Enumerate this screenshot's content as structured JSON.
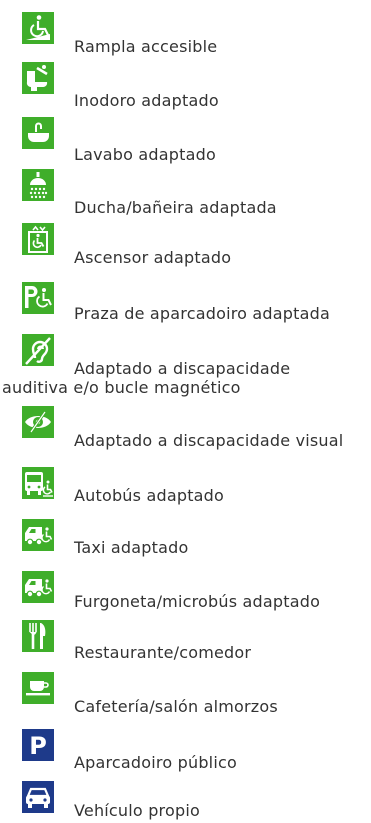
{
  "colors": {
    "green": "#3fae2a",
    "blue": "#1e3a8a",
    "text": "#333333"
  },
  "items": [
    {
      "label": "Rampla accesible",
      "icon": "wheelchair-ramp-icon"
    },
    {
      "label": "Inodoro adaptado",
      "icon": "toilet-icon"
    },
    {
      "label": "Lavabo adaptado",
      "icon": "washbasin-icon"
    },
    {
      "label": "Ducha/bañeira adaptada",
      "icon": "shower-icon"
    },
    {
      "label": "Ascensor adaptado",
      "icon": "elevator-icon"
    },
    {
      "label": "Praza de aparcadoiro adaptada",
      "icon": "accessible-parking-icon"
    },
    {
      "label_line1": "Adaptado a discapacidade",
      "label_line2": "auditiva e/o bucle magnético",
      "icon": "hearing-loop-icon"
    },
    {
      "label": "Adaptado a discapacidade visual",
      "icon": "visual-impairment-icon"
    },
    {
      "label": "Autobús adaptado",
      "icon": "accessible-bus-icon"
    },
    {
      "label": "Taxi adaptado",
      "icon": "accessible-taxi-icon"
    },
    {
      "label": "Furgoneta/microbús adaptado",
      "icon": "accessible-van-icon"
    },
    {
      "label": "Restaurante/comedor",
      "icon": "fork-knife-icon"
    },
    {
      "label": "Cafetería/salón almorzos",
      "icon": "coffee-cup-icon"
    },
    {
      "label": "Aparcadoiro público",
      "icon": "parking-icon",
      "icon_letter": "P"
    },
    {
      "label": "Vehículo propio",
      "icon": "car-icon"
    }
  ]
}
